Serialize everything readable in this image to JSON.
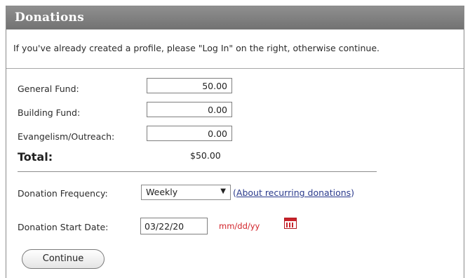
{
  "header": {
    "title": "Donations"
  },
  "intro_text": "If you've already created a profile, please \"Log In\" on the right, otherwise continue.",
  "funds": [
    {
      "label": "General Fund:",
      "value": "50.00"
    },
    {
      "label": "Building Fund:",
      "value": "0.00"
    },
    {
      "label": "Evangelism/Outreach:",
      "value": "0.00"
    }
  ],
  "total": {
    "label": "Total:",
    "value": "$50.00"
  },
  "frequency": {
    "label": "Donation Frequency:",
    "selected": "Weekly",
    "link_prefix": "(",
    "link_text": "About recurring donations",
    "link_suffix": ")"
  },
  "start_date": {
    "label": "Donation Start Date:",
    "value": "03/22/20",
    "format_hint": "mm/dd/yy",
    "icon": "calendar-icon"
  },
  "continue_label": "Continue",
  "colors": {
    "header_bg": "#808080",
    "hint_red": "#d2232a",
    "link_blue": "#2a3a8c"
  }
}
